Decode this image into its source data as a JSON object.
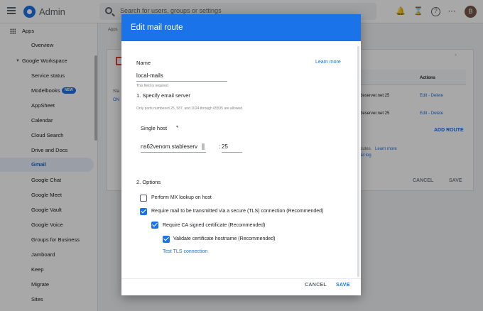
{
  "app": {
    "title": "Admin",
    "search_placeholder": "Search for users, groups or settings",
    "avatar_initial": "B",
    "accent": "#1a73e8"
  },
  "sidebar": {
    "apps_label": "Apps",
    "items": [
      {
        "label": "Overview"
      },
      {
        "label": "Google Workspace"
      },
      {
        "label": "Service status"
      },
      {
        "label": "Modelbooks",
        "badge": "NEW"
      },
      {
        "label": "AppSheet"
      },
      {
        "label": "Calendar"
      },
      {
        "label": "Cloud Search"
      },
      {
        "label": "Drive and Docs"
      },
      {
        "label": "Gmail"
      },
      {
        "label": "Google Chat"
      },
      {
        "label": "Google Meet"
      },
      {
        "label": "Google Vault"
      },
      {
        "label": "Google Voice"
      },
      {
        "label": "Groups for Business"
      },
      {
        "label": "Jamboard"
      },
      {
        "label": "Keep"
      },
      {
        "label": "Migrate"
      },
      {
        "label": "Sites"
      }
    ]
  },
  "background": {
    "breadcrumb_fragment": "Apps",
    "col_actions": "Actions",
    "row1_server": "deserver.net:25",
    "row2_server": "deserver.net:25",
    "row_action": "Edit - Delete",
    "add_route": "ADD ROUTE",
    "note_routes": "outes.",
    "note_learn": "Learn more",
    "note_log": "ail log",
    "cancel": "CANCEL",
    "save": "SAVE",
    "status_fragment": "Sta",
    "on_fragment": "ON"
  },
  "dialog": {
    "title": "Edit mail route",
    "name_label": "Name",
    "learn_more": "Learn more",
    "name_value": "local-mails",
    "required_hint": "This field is required",
    "section1": "1. Specify email server",
    "ports_hint": "Only ports numbered 25, 587, and 1024 through 65535 are allowed.",
    "host_mode": "Single host",
    "host_value": "ns62venom.stableserv",
    "port_sep": ":",
    "port_value": "25",
    "section2": "2. Options",
    "options": [
      {
        "label": "Perform MX lookup on host",
        "checked": false
      },
      {
        "label": "Require mail to be transmitted via a secure (TLS) connection (Recommended)",
        "checked": true
      },
      {
        "label": "Require CA signed certificate (Recommended)",
        "checked": true
      },
      {
        "label": "Validate certificate hostname (Recommended)",
        "checked": true
      }
    ],
    "test_tls": "Test TLS connection",
    "cancel": "CANCEL",
    "save": "SAVE"
  }
}
